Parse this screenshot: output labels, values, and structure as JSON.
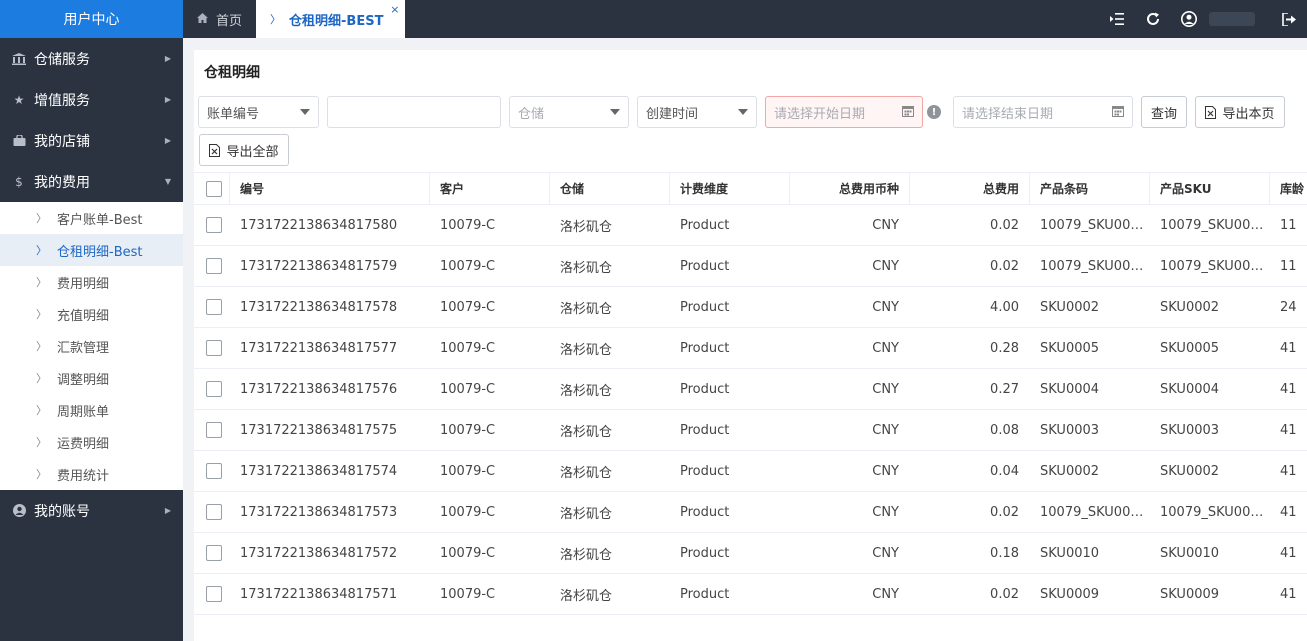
{
  "sidebar": {
    "brand": "用户中心",
    "menu": [
      {
        "label": "仓储服务",
        "icon": "bank-icon"
      },
      {
        "label": "增值服务",
        "icon": "star-icon"
      },
      {
        "label": "我的店铺",
        "icon": "shop-icon"
      },
      {
        "label": "我的费用",
        "icon": "dollar-icon",
        "expanded": true
      }
    ],
    "submenu": [
      {
        "label": "客户账单-Best"
      },
      {
        "label": "仓租明细-Best",
        "active": true
      },
      {
        "label": "费用明细"
      },
      {
        "label": "充值明细"
      },
      {
        "label": "汇款管理"
      },
      {
        "label": "调整明细"
      },
      {
        "label": "周期账单"
      },
      {
        "label": "运费明细"
      },
      {
        "label": "费用统计"
      }
    ],
    "account": {
      "label": "我的账号",
      "icon": "user-circle-icon"
    }
  },
  "tabs": {
    "home": "首页",
    "active": "仓租明细-BEST",
    "close": "×"
  },
  "page": {
    "title": "仓租明细"
  },
  "filters": {
    "bill_type": "账单编号",
    "bill_input": "",
    "warehouse_placeholder": "仓储",
    "time_type": "创建时间",
    "start_date_placeholder": "请选择开始日期",
    "end_date_placeholder": "请选择结束日期",
    "info": "!"
  },
  "buttons": {
    "query": "查询",
    "export_page": "导出本页",
    "export_all": "导出全部"
  },
  "table": {
    "headers": {
      "id": "编号",
      "customer": "客户",
      "warehouse": "仓储",
      "dimension": "计费维度",
      "currency": "总费用币种",
      "total": "总费用",
      "barcode": "产品条码",
      "sku": "产品SKU",
      "age": "库龄"
    },
    "rows": [
      {
        "id": "1731722138634817580",
        "customer": "10079-C",
        "warehouse": "洛杉矶仓",
        "dimension": "Product",
        "currency": "CNY",
        "total": "0.02",
        "barcode": "10079_SKU00…",
        "sku": "10079_SKU00…",
        "age": "11"
      },
      {
        "id": "1731722138634817579",
        "customer": "10079-C",
        "warehouse": "洛杉矶仓",
        "dimension": "Product",
        "currency": "CNY",
        "total": "0.02",
        "barcode": "10079_SKU00…",
        "sku": "10079_SKU00…",
        "age": "11"
      },
      {
        "id": "1731722138634817578",
        "customer": "10079-C",
        "warehouse": "洛杉矶仓",
        "dimension": "Product",
        "currency": "CNY",
        "total": "4.00",
        "barcode": "SKU0002",
        "sku": "SKU0002",
        "age": "24"
      },
      {
        "id": "1731722138634817577",
        "customer": "10079-C",
        "warehouse": "洛杉矶仓",
        "dimension": "Product",
        "currency": "CNY",
        "total": "0.28",
        "barcode": "SKU0005",
        "sku": "SKU0005",
        "age": "41"
      },
      {
        "id": "1731722138634817576",
        "customer": "10079-C",
        "warehouse": "洛杉矶仓",
        "dimension": "Product",
        "currency": "CNY",
        "total": "0.27",
        "barcode": "SKU0004",
        "sku": "SKU0004",
        "age": "41"
      },
      {
        "id": "1731722138634817575",
        "customer": "10079-C",
        "warehouse": "洛杉矶仓",
        "dimension": "Product",
        "currency": "CNY",
        "total": "0.08",
        "barcode": "SKU0003",
        "sku": "SKU0003",
        "age": "41"
      },
      {
        "id": "1731722138634817574",
        "customer": "10079-C",
        "warehouse": "洛杉矶仓",
        "dimension": "Product",
        "currency": "CNY",
        "total": "0.04",
        "barcode": "SKU0002",
        "sku": "SKU0002",
        "age": "41"
      },
      {
        "id": "1731722138634817573",
        "customer": "10079-C",
        "warehouse": "洛杉矶仓",
        "dimension": "Product",
        "currency": "CNY",
        "total": "0.02",
        "barcode": "10079_SKU00…",
        "sku": "10079_SKU00…",
        "age": "41"
      },
      {
        "id": "1731722138634817572",
        "customer": "10079-C",
        "warehouse": "洛杉矶仓",
        "dimension": "Product",
        "currency": "CNY",
        "total": "0.18",
        "barcode": "SKU0010",
        "sku": "SKU0010",
        "age": "41"
      },
      {
        "id": "1731722138634817571",
        "customer": "10079-C",
        "warehouse": "洛杉矶仓",
        "dimension": "Product",
        "currency": "CNY",
        "total": "0.02",
        "barcode": "SKU0009",
        "sku": "SKU0009",
        "age": "41"
      }
    ]
  },
  "colors": {
    "brand": "#1d7ce0",
    "sidebar_bg": "#2b3340",
    "active_text": "#1d66c4"
  }
}
